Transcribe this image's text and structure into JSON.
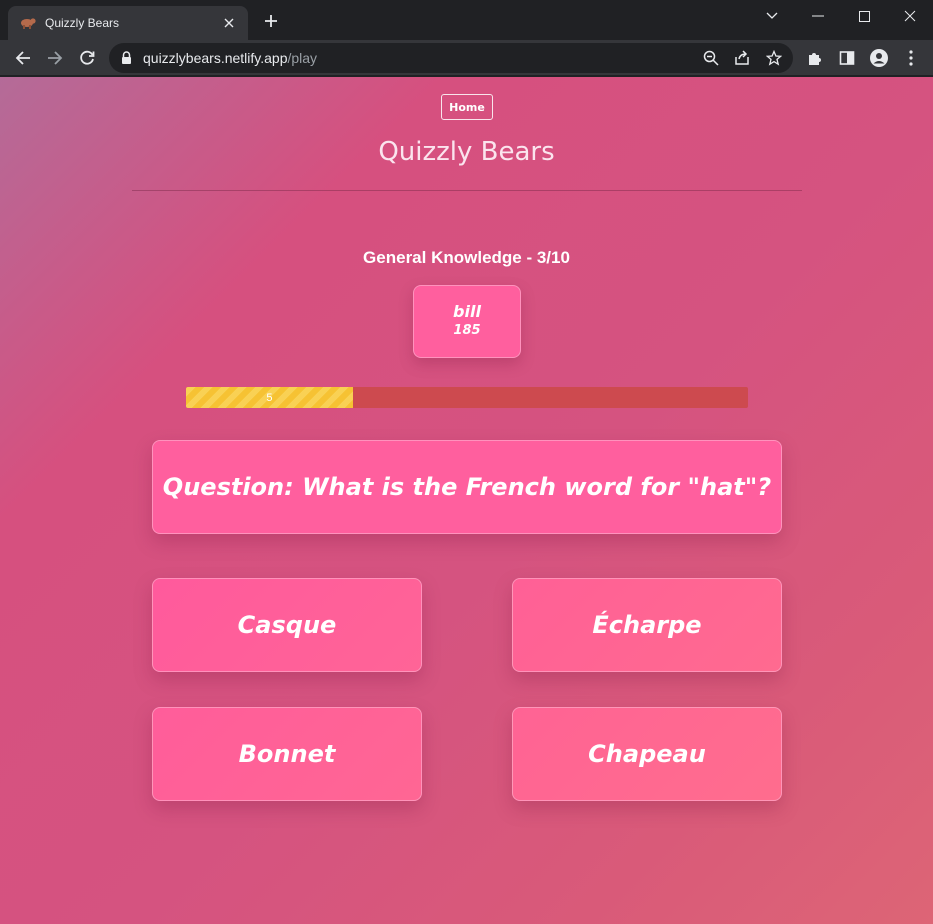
{
  "browser": {
    "tab_title": "Quizzly Bears",
    "url_host": "quizzlybears.netlify.app",
    "url_path": "/play",
    "favicon": "bear-icon",
    "colors": {
      "frame": "#202124",
      "toolbar": "#35363a",
      "text": "#e8eaed"
    }
  },
  "page": {
    "home_label": "Home",
    "title": "Quizzly Bears",
    "category_progress": "General Knowledge - 3/10",
    "player": {
      "name": "bill",
      "score": "185"
    },
    "timer": {
      "label": "5",
      "fraction_remaining": 0.297
    },
    "question": "Question: What is the French word for \"hat\"?",
    "answers": [
      "Casque",
      "Écharpe",
      "Bonnet",
      "Chapeau"
    ],
    "colors": {
      "background_start": "#b46b98",
      "background_end": "#dd6576",
      "card": "#ff5f9e",
      "timer_fill": "#f6c233",
      "timer_track": "#cd4a4f"
    }
  }
}
